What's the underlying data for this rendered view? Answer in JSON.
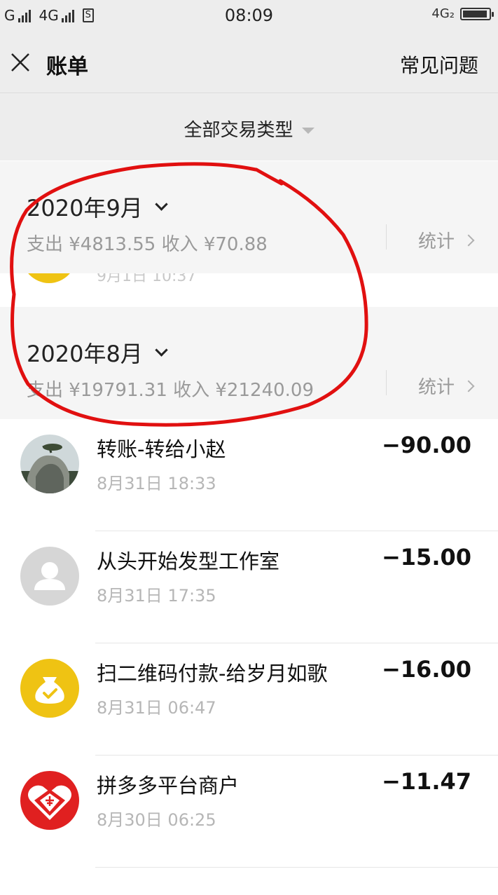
{
  "status_bar": {
    "carrier_1": "G",
    "carrier_2": "4G",
    "sim_glyph": "S",
    "time": "08:09",
    "network_right": "4G₂"
  },
  "header": {
    "close_icon": "close-icon",
    "title": "账单",
    "faq": "常见问题"
  },
  "filter": {
    "label": "全部交易类型"
  },
  "months": [
    {
      "title": "2020年9月",
      "summary": "支出 ¥4813.55 收入 ¥70.88",
      "stats": "统计"
    },
    {
      "title": "2020年8月",
      "summary": "支出 ¥19791.31 收入 ¥21240.09",
      "stats": "统计"
    }
  ],
  "partial_row": {
    "time": "9月1日 10:37"
  },
  "transactions": [
    {
      "title": "转账-转给小赵",
      "time": "8月31日 18:33",
      "amount": "−90.00",
      "avatar": "landscape-photo"
    },
    {
      "title": "从头开始发型工作室",
      "time": "8月31日 17:35",
      "amount": "−15.00",
      "avatar": "default-user-icon"
    },
    {
      "title": "扫二维码付款-给岁月如歌",
      "time": "8月31日 06:47",
      "amount": "−16.00",
      "avatar": "money-bag-icon"
    },
    {
      "title": "拼多多平台商户",
      "time": "8月30日 06:25",
      "amount": "−11.47",
      "avatar": "pinduoduo-logo"
    }
  ],
  "colors": {
    "header_bg": "#ededed",
    "month_bg": "#f5f5f5",
    "annotation_red": "#e11010",
    "wallet_yellow": "#efc313",
    "pdd_red": "#e02020"
  }
}
